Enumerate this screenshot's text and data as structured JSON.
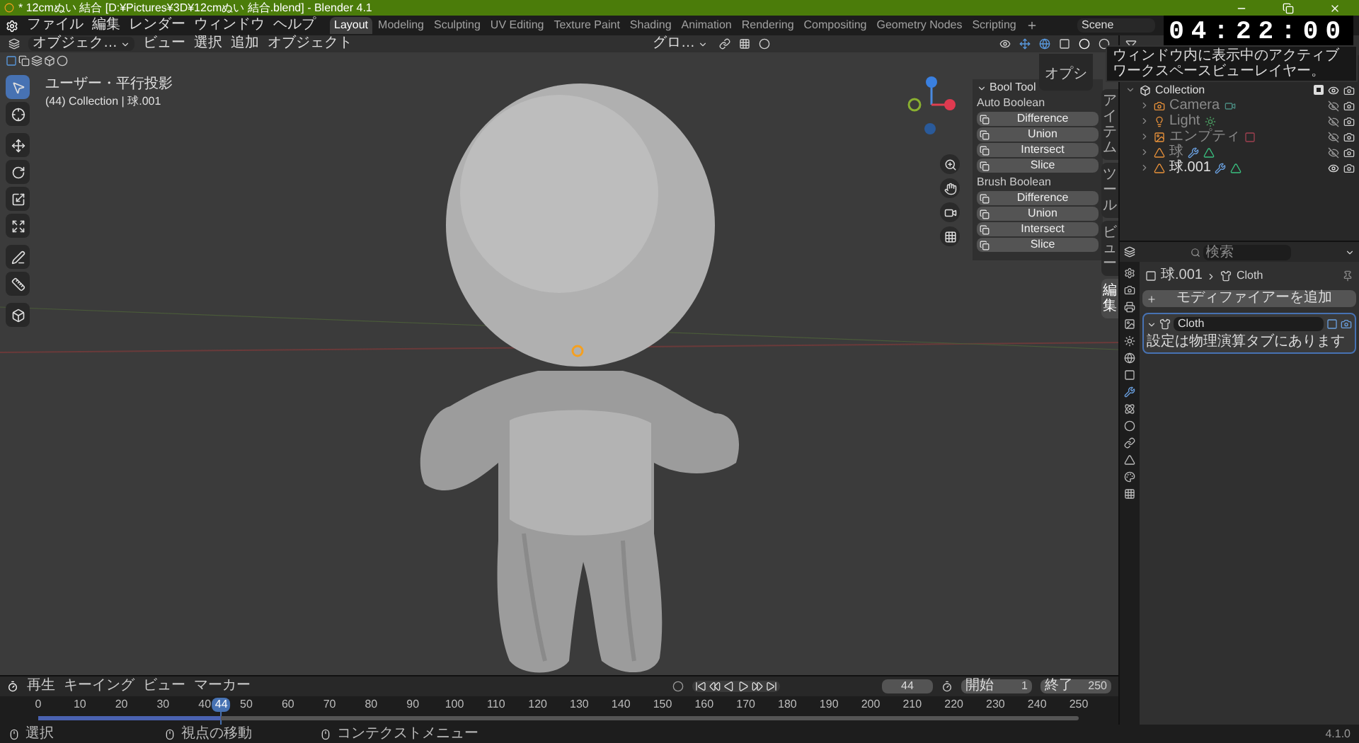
{
  "window": {
    "title": "* 12cmぬい 結合 [D:¥Pictures¥3D¥12cmぬい 結合.blend] - Blender 4.1"
  },
  "menu": [
    "ファイル",
    "編集",
    "レンダー",
    "ウィンドウ",
    "ヘルプ"
  ],
  "workspaces": [
    {
      "label": "Layout",
      "selected": true
    },
    {
      "label": "Modeling",
      "selected": false
    },
    {
      "label": "Sculpting",
      "selected": false
    },
    {
      "label": "UV Editing",
      "selected": false
    },
    {
      "label": "Texture Paint",
      "selected": false
    },
    {
      "label": "Shading",
      "selected": false
    },
    {
      "label": "Animation",
      "selected": false
    },
    {
      "label": "Rendering",
      "selected": false
    },
    {
      "label": "Compositing",
      "selected": false
    },
    {
      "label": "Geometry Nodes",
      "selected": false
    },
    {
      "label": "Scripting",
      "selected": false
    }
  ],
  "scene": {
    "value": "Scene"
  },
  "timer": "04:22:00",
  "tooltip": "ウィンドウ内に表示中のアクティブワークスペースビューレイヤー。",
  "viewport": {
    "header": {
      "mode": "オブジェク…",
      "menus": [
        "ビュー",
        "選択",
        "追加",
        "オブジェクト"
      ],
      "orientation": "グロ…",
      "options": "オプシ"
    },
    "info": [
      "ユーザー・平行投影",
      "(44) Collection | 球.001"
    ],
    "tools": [
      {
        "kind": "select",
        "selected": true
      },
      {
        "kind": "cursor",
        "selected": false
      },
      {
        "kind": "move",
        "selected": false
      },
      {
        "kind": "rotate",
        "selected": false
      },
      {
        "kind": "scale",
        "selected": false
      },
      {
        "kind": "transform",
        "selected": false
      },
      {
        "kind": "annotate",
        "selected": false
      },
      {
        "kind": "measure",
        "selected": false
      },
      {
        "kind": "add-cube",
        "selected": false
      }
    ]
  },
  "bool_tool": {
    "title": "Bool Tool",
    "sections": [
      {
        "title": "Auto Boolean",
        "buttons": [
          "Difference",
          "Union",
          "Intersect",
          "Slice"
        ]
      },
      {
        "title": "Brush Boolean",
        "buttons": [
          "Difference",
          "Union",
          "Intersect",
          "Slice"
        ]
      }
    ]
  },
  "sidebar_tabs": [
    {
      "label": "アイテム",
      "selected": false
    },
    {
      "label": "ツール",
      "selected": false
    },
    {
      "label": "ビュー",
      "selected": false
    },
    {
      "label": "編集",
      "selected": true
    }
  ],
  "outliner": {
    "collection": {
      "name": "Collection",
      "checked": true,
      "children": [
        {
          "name": "Camera",
          "kind": "camera",
          "visible": false
        },
        {
          "name": "Light",
          "kind": "light",
          "visible": false
        },
        {
          "name": "エンプティ",
          "kind": "empty",
          "visible": false
        },
        {
          "name": "球",
          "kind": "mesh",
          "visible": false
        },
        {
          "name": "球.001",
          "kind": "mesh",
          "visible": true
        }
      ]
    }
  },
  "properties": {
    "search": {
      "placeholder": "検索"
    },
    "breadcrumb": [
      "球.001",
      "Cloth"
    ],
    "add_modifier": "モディファイアーを追加",
    "modifier": {
      "name": "Cloth",
      "expanded": true,
      "note": "設定は物理演算タブにあります"
    }
  },
  "timeline": {
    "menus": [
      "再生",
      "キーイング",
      "ビュー",
      "マーカー"
    ],
    "current_frame": "44",
    "start_label": "開始",
    "start": "1",
    "end_label": "終了",
    "end": "250",
    "ticks": [
      "0",
      "10",
      "20",
      "30",
      "40",
      "50",
      "60",
      "70",
      "80",
      "90",
      "100",
      "110",
      "120",
      "130",
      "140",
      "150",
      "160",
      "170",
      "180",
      "190",
      "200",
      "210",
      "220",
      "230",
      "240",
      "250"
    ],
    "playhead": {
      "label": "44",
      "level": 0.176
    }
  },
  "status_bar": {
    "hints": [
      "選択",
      "視点の移動",
      "コンテクストメニュー"
    ],
    "version": "4.1.0"
  }
}
